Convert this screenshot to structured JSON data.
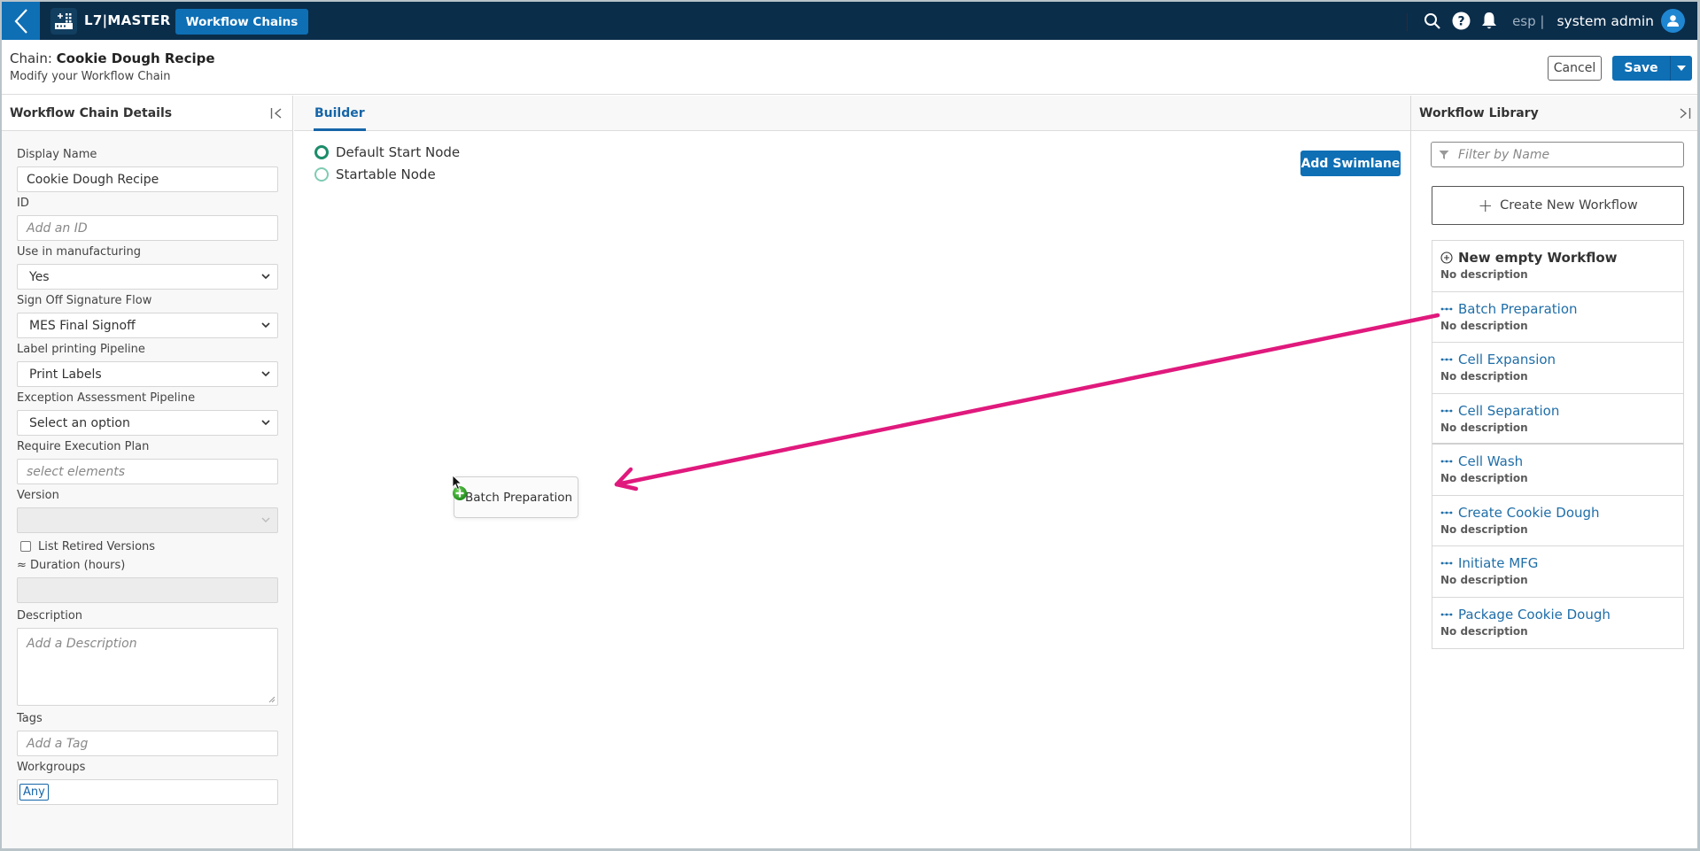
{
  "topnav": {
    "back_icon": "chevron-left-icon",
    "logo_icon": "app-grid-logo-icon",
    "brand": "L7|MASTER",
    "active_tab": "Workflow Chains",
    "icons": [
      "search-icon",
      "help-icon",
      "bell-icon"
    ],
    "lab": "esp |",
    "user": "system admin",
    "avatar_icon": "user-avatar-icon"
  },
  "subheader": {
    "title_prefix": "Chain: ",
    "title_name": "Cookie Dough Recipe",
    "subtitle": "Modify your Workflow Chain",
    "cancel_label": "Cancel",
    "save_label": "Save"
  },
  "details_panel": {
    "title": "Workflow Chain Details",
    "fields": {
      "display_name": {
        "label": "Display Name",
        "value": "Cookie Dough Recipe"
      },
      "id": {
        "label": "ID",
        "placeholder": "Add an ID"
      },
      "use_in_manufacturing": {
        "label": "Use in manufacturing",
        "value": "Yes"
      },
      "sign_off_flow": {
        "label": "Sign Off Signature Flow",
        "value": "MES Final Signoff"
      },
      "label_pipeline": {
        "label": "Label printing Pipeline",
        "value": "Print Labels"
      },
      "exception_pipeline": {
        "label": "Exception Assessment Pipeline",
        "value": "Select an option"
      },
      "execution_plan": {
        "label": "Require Execution Plan",
        "placeholder": "select elements"
      },
      "version": {
        "label": "Version",
        "value": ""
      },
      "list_retired": {
        "label": "List Retired Versions",
        "checked": false
      },
      "duration": {
        "label": "≈ Duration (hours)",
        "value": ""
      },
      "description": {
        "label": "Description",
        "placeholder": "Add a Description"
      },
      "tags": {
        "label": "Tags",
        "placeholder": "Add a Tag"
      },
      "workgroups": {
        "label": "Workgroups",
        "chips": [
          "Any"
        ]
      }
    }
  },
  "builder": {
    "tab_label": "Builder",
    "legend": [
      {
        "label": "Default Start Node",
        "kind": "default"
      },
      {
        "label": "Startable Node",
        "kind": "startable"
      }
    ],
    "add_swimlane_label": "Add Swimlane",
    "dragging_node_label": "Batch Preparation",
    "annotation_color": "#e0197d"
  },
  "library": {
    "title": "Workflow Library",
    "filter_placeholder": "Filter by Name",
    "create_label": "Create New Workflow",
    "items": [
      {
        "name": "New empty Workflow",
        "description": "No description",
        "kind": "new"
      },
      {
        "name": "Batch Preparation",
        "description": "No description",
        "kind": "workflow"
      },
      {
        "name": "Cell Expansion",
        "description": "No description",
        "kind": "workflow"
      },
      {
        "name": "Cell Separation",
        "description": "No description",
        "kind": "workflow"
      },
      {
        "name": "Cell Wash",
        "description": "No description",
        "kind": "workflow"
      },
      {
        "name": "Create Cookie Dough",
        "description": "No description",
        "kind": "workflow"
      },
      {
        "name": "Initiate MFG",
        "description": "No description",
        "kind": "workflow"
      },
      {
        "name": "Package Cookie Dough",
        "description": "No description",
        "kind": "workflow"
      }
    ]
  },
  "colors": {
    "nav_bg": "#0a2d4a",
    "primary": "#0e6fb5",
    "link": "#1f6ea8",
    "default_node": "#1c8c6a",
    "startable_node": "#7fcbb3",
    "annotation": "#e0197d"
  }
}
